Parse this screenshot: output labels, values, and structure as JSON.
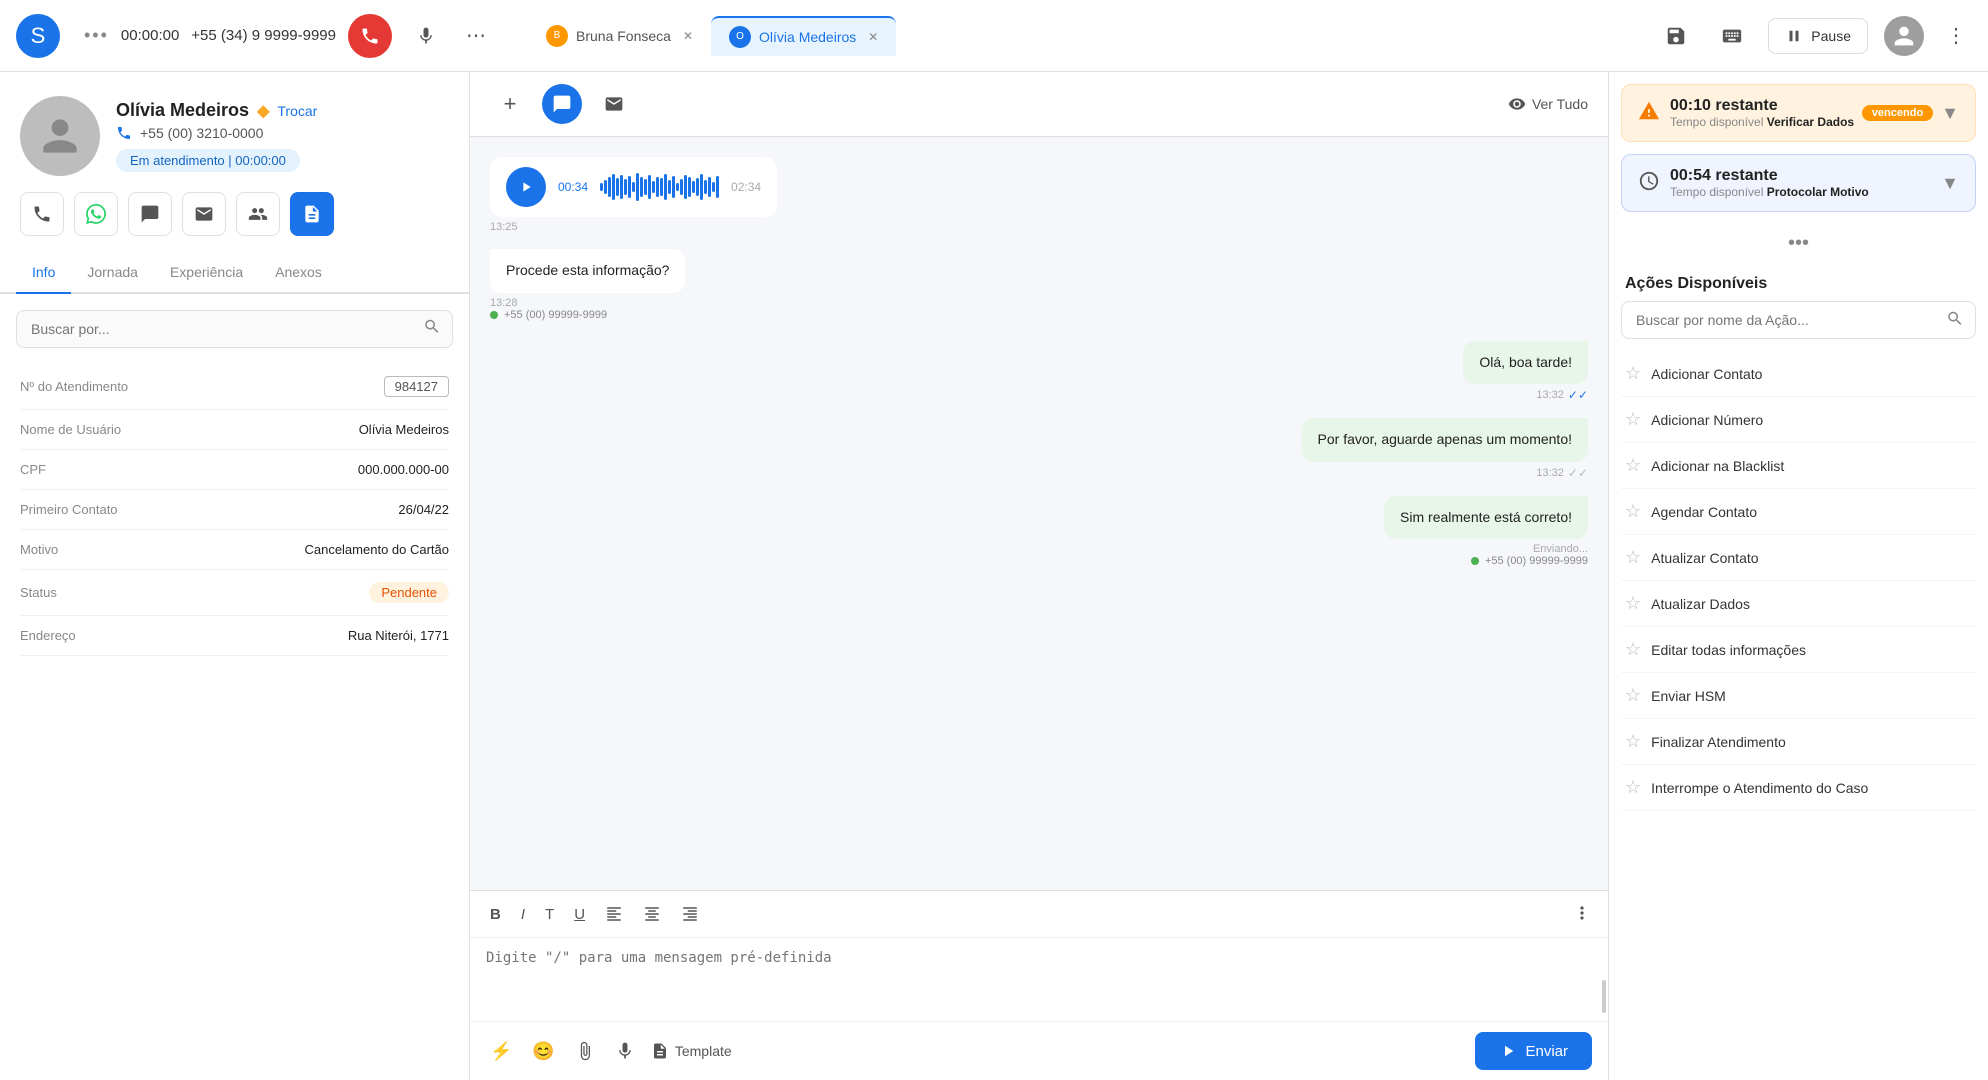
{
  "app": {
    "logo": "S",
    "call": {
      "timer": "00:00:00",
      "number": "+55 (34) 9 9999-9999",
      "end_call_icon": "📞",
      "mic_icon": "🎤",
      "more_icon": "⋯"
    },
    "tabs": [
      {
        "id": "bruna",
        "label": "Bruna Fonseca",
        "active": false,
        "color": "orange"
      },
      {
        "id": "olivia",
        "label": "Olívia Medeiros",
        "active": true,
        "color": "blue"
      }
    ],
    "top_right": {
      "pause_label": "Pause",
      "icons": [
        "💾",
        "⌨️"
      ]
    }
  },
  "left_panel": {
    "contact": {
      "name": "Olívia Medeiros",
      "edit_label": "Trocar",
      "phone": "+55 (00) 3210-0000",
      "status": "Em atendimento | 00:00:00"
    },
    "action_icons": [
      "📞",
      "💬",
      "📝",
      "✉️",
      "👤",
      "📋"
    ],
    "nav_tabs": [
      "Info",
      "Jornada",
      "Experiência",
      "Anexos"
    ],
    "active_nav_tab": "Info",
    "search_placeholder": "Buscar por...",
    "fields": [
      {
        "label": "Nº do Atendimento",
        "value": "984127",
        "type": "bordered"
      },
      {
        "label": "Nome de Usuário",
        "value": "Olívia Medeiros",
        "type": "bold"
      },
      {
        "label": "CPF",
        "value": "000.000.000-00",
        "type": "normal"
      },
      {
        "label": "Primeiro Contato",
        "value": "26/04/22",
        "type": "normal"
      },
      {
        "label": "Motivo",
        "value": "Cancelamento do Cartão",
        "type": "bold"
      },
      {
        "label": "Status",
        "value": "Pendente",
        "type": "badge"
      },
      {
        "label": "Endereço",
        "value": "Rua Niterói, 1771",
        "type": "bold"
      }
    ]
  },
  "chat": {
    "header_buttons": [
      "+",
      "💬",
      "✉️"
    ],
    "ver_tudo_label": "Ver Tudo",
    "messages": [
      {
        "type": "audio",
        "side": "left",
        "time_elapsed": "00:34",
        "duration": "02:34",
        "timestamp": "13:25",
        "sender_phone": "+55 (00) 99999-9999"
      },
      {
        "type": "text",
        "side": "left",
        "text": "Procede esta informação?",
        "timestamp": "13:28",
        "sender_phone": "+55 (00) 99999-9999"
      },
      {
        "type": "text",
        "side": "right",
        "text": "Olá, boa tarde!",
        "timestamp": "13:32",
        "checks": "double-blue"
      },
      {
        "type": "text",
        "side": "right",
        "text": "Por favor, aguarde apenas um momento!",
        "timestamp": "13:32",
        "checks": "double-gray"
      },
      {
        "type": "text",
        "side": "right",
        "text": "Sim realmente está correto!",
        "timestamp": "Enviando...",
        "sender_phone": "+55 (00) 99999-9999"
      }
    ],
    "composer": {
      "toolbar_buttons": [
        "B",
        "I",
        "T",
        "U",
        "≡",
        "≡",
        "≡"
      ],
      "placeholder": "Digite \"/\" para uma mensagem pré-definida",
      "bottom_buttons": [
        "⚡",
        "😊",
        "📎",
        "🎤"
      ],
      "template_label": "Template",
      "send_label": "Enviar"
    }
  },
  "right_panel": {
    "timers": [
      {
        "time": "00:10 restante",
        "badge": "vencendo",
        "label_prefix": "Tempo disponível",
        "label_value": "Verificar Dados",
        "type": "warning"
      },
      {
        "time": "00:54 restante",
        "badge": null,
        "label_prefix": "Tempo disponível",
        "label_value": "Protocolar Motivo",
        "type": "info"
      }
    ],
    "acoes_title": "Ações Disponíveis",
    "acoes_search_placeholder": "Buscar por nome da Ação...",
    "acoes_items": [
      "Adicionar Contato",
      "Adicionar Número",
      "Adicionar na Blacklist",
      "Agendar Contato",
      "Atualizar Contato",
      "Atualizar Dados",
      "Editar todas informações",
      "Enviar HSM",
      "Finalizar Atendimento",
      "Interrompe o Atendimento do Caso"
    ]
  }
}
